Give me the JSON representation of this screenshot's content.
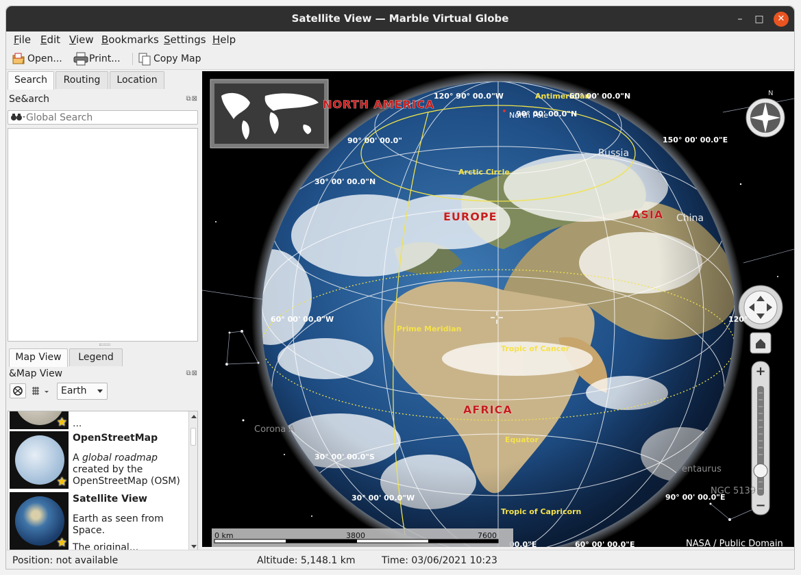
{
  "window": {
    "title": "Satellite View — Marble Virtual Globe"
  },
  "window_controls": {
    "minimize": "–",
    "maximize": "□",
    "close": "✕"
  },
  "menu": {
    "file": {
      "mnemonic": "F",
      "rest": "ile"
    },
    "edit": {
      "mnemonic": "E",
      "rest": "dit"
    },
    "view": {
      "mnemonic": "V",
      "rest": "iew"
    },
    "bookmarks": {
      "mnemonic": "B",
      "rest": "ookmarks"
    },
    "settings": {
      "mnemonic": "S",
      "rest": "ettings"
    },
    "help": {
      "mnemonic": "H",
      "rest": "elp"
    }
  },
  "toolbar": {
    "open": "Open...",
    "print": "Print...",
    "copy_map": "Copy Map"
  },
  "left_panel": {
    "tabs": {
      "search": "Search",
      "routing": "Routing",
      "location": "Location"
    },
    "search_dock": {
      "title": "Se&arch",
      "placeholder": "Global Search"
    },
    "view_tabs": {
      "map_view": "Map View",
      "legend": "Legend"
    },
    "map_view_dock": {
      "title": "&Map View",
      "celestial_body": "Earth"
    },
    "themes": {
      "partial_text": "...",
      "osm": {
        "name": "OpenStreetMap",
        "desc_pre": "A ",
        "desc_em": "global roadmap",
        "desc_post": " created by the OpenStreetMap (OSM)"
      },
      "satellite": {
        "name": "Satellite View",
        "desc": "Earth as seen from Space.",
        "desc_more": "The original..."
      }
    }
  },
  "map": {
    "continents": {
      "north_america": "NORTH AMERICA",
      "europe": "EUROPE",
      "asia": "ASIA",
      "africa": "AFRICA"
    },
    "countries": {
      "russia": "Russia",
      "china": "China"
    },
    "places": {
      "north_pole": "North Pole"
    },
    "lines": {
      "arctic_circle": "Arctic Circle",
      "prime_meridian": "Prime Meridian",
      "tropic_cancer": "Tropic of Cancer",
      "equator": "Equator",
      "tropic_capricorn": "Tropic of Capricorn",
      "antimeridian": "Antimeridian"
    },
    "coords": {
      "c120w_top": "120° 90° 00.0\"W",
      "c60n_top": "60° 00' 00.0\"N",
      "c90w": "90° 00' 00.0\"",
      "c90n": "90° 00' 00.0\"N",
      "c150e": "150° 00' 00.0\"E",
      "c30n": "30° 00' 00.0\"N",
      "c60w": "60° 00' 00.0\"W",
      "c120e": "120°",
      "c30s": "30° 00' 00.0\"S",
      "c30w": "30° 00' 00.0\"W",
      "c90e": "90° 00' 00.0\"E",
      "c60s_e": "60° 00' 00.0\"E",
      "c00e": "00.0\"E"
    },
    "stars": {
      "corona": "Corona A",
      "centaurus": "entaurus",
      "ngc": "NGC 5139"
    },
    "compass_n": "N",
    "scale": {
      "s0": "0 km",
      "s1": "3800",
      "s2": "7600"
    },
    "credit": "NASA / Public Domain",
    "zoom_plus": "+",
    "zoom_minus": "−",
    "zoom_level": 0.22
  },
  "status": {
    "position": "Position: not available",
    "altitude": "Altitude:  5,148.1 km",
    "time": "Time: 03/06/2021 10:23"
  }
}
